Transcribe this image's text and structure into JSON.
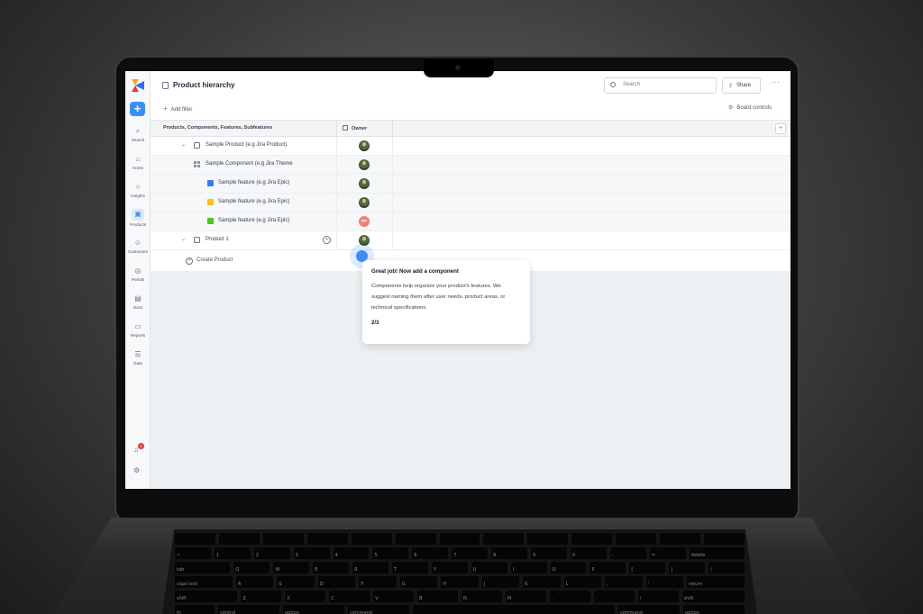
{
  "page": {
    "title": "Product hierarchy"
  },
  "sidebar": {
    "add_label": "+",
    "items": [
      {
        "label": "Search",
        "icon": "search-icon"
      },
      {
        "label": "Home",
        "icon": "home-icon"
      },
      {
        "label": "Insights",
        "icon": "lightbulb-icon"
      },
      {
        "label": "Products",
        "icon": "products-icon"
      },
      {
        "label": "Customers",
        "icon": "customers-icon"
      },
      {
        "label": "Portals",
        "icon": "portals-icon"
      },
      {
        "label": "Docs",
        "icon": "docs-icon"
      },
      {
        "label": "Reports",
        "icon": "reports-icon"
      },
      {
        "label": "Data",
        "icon": "data-icon"
      }
    ],
    "notification_count": "1"
  },
  "header": {
    "search_placeholder": "Search",
    "share_label": "Share",
    "more_label": "···"
  },
  "toolbar": {
    "add_filter_label": "Add filter",
    "board_controls_label": "Board controls"
  },
  "table": {
    "columns": {
      "name": "Products, Components, Features, Subfeatures",
      "owner": "Owner"
    },
    "rows": [
      {
        "label": "Sample Product (e.g Jira Product)",
        "type": "product",
        "owner": "photo"
      },
      {
        "label": "Sample Component (e.g Jira Theme",
        "type": "component",
        "owner": "photo"
      },
      {
        "label": "Sample feature (e.g Jira Epic)",
        "type": "feature",
        "color": "#2f80ed",
        "owner": "photo"
      },
      {
        "label": "Sample feature (e.g Jira Epic)",
        "type": "feature",
        "color": "#f5c518",
        "owner": "photo"
      },
      {
        "label": "Sample feature (e.g Jira Epic)",
        "type": "feature",
        "color": "#52c41a",
        "owner": "PP"
      },
      {
        "label": "Product 1",
        "type": "product",
        "owner": "photo"
      }
    ],
    "create_label": "Create Product"
  },
  "onboarding": {
    "title": "Great job! Now add a component",
    "body": "Components help organize your product's features. We suggest naming them after user needs, product areas, or technical specifications.",
    "step": "2/3"
  },
  "keyboard": {
    "row1": [
      "",
      "",
      "",
      "",
      "",
      "",
      "",
      "",
      "",
      "",
      "",
      "",
      ""
    ],
    "row2": [
      "~",
      "1",
      "2",
      "3",
      "4",
      "5",
      "6",
      "7",
      "8",
      "9",
      "0",
      "-",
      "=",
      "delete"
    ],
    "row3": [
      "tab",
      "Q",
      "W",
      "E",
      "R",
      "T",
      "Y",
      "U",
      "I",
      "O",
      "P",
      "[",
      "]",
      "\\"
    ],
    "row4": [
      "caps lock",
      "A",
      "S",
      "D",
      "F",
      "G",
      "H",
      "J",
      "K",
      "L",
      ";",
      "'",
      "return"
    ],
    "row5": [
      "shift",
      "Z",
      "X",
      "C",
      "V",
      "B",
      "N",
      "M",
      ",",
      ".",
      "/",
      "shift"
    ],
    "row6": [
      "fn",
      "control",
      "option",
      "command",
      "",
      "command",
      "option"
    ]
  }
}
